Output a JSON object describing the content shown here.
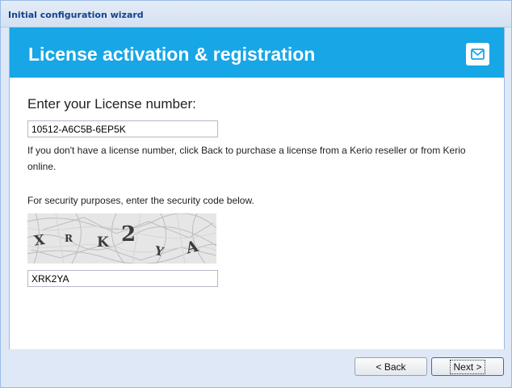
{
  "window": {
    "title": "Initial configuration wizard"
  },
  "banner": {
    "title": "License activation & registration",
    "icon": "envelope-icon"
  },
  "license": {
    "heading": "Enter your License number:",
    "value": "10512-A6C5B-6EP5K",
    "info": "If you don't have a license number, click Back to purchase a license from a Kerio reseller or from Kerio online."
  },
  "security": {
    "instructions": "For security purposes, enter the security code below.",
    "captcha_text": "XRK2YA",
    "code_value": "XRK2YA"
  },
  "buttons": {
    "back": "< Back",
    "next": "Next >"
  },
  "colors": {
    "banner": "#17a6e6",
    "window_bg": "#dfe8f6",
    "title_text": "#15428b"
  }
}
